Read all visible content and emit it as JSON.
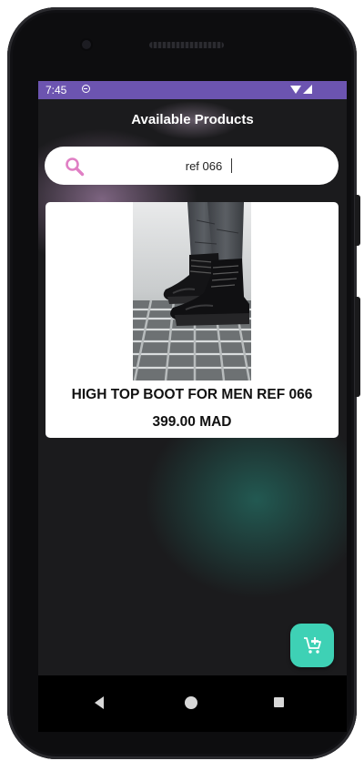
{
  "status_bar": {
    "time": "7:45"
  },
  "app_bar": {
    "title": "Available Products"
  },
  "search": {
    "value": "ref 066",
    "icon": "search-icon"
  },
  "products": [
    {
      "name": "HIGH TOP BOOT FOR MEN REF 066",
      "price": "399.00 MAD",
      "image": "black high top leather boots"
    }
  ],
  "fab": {
    "icon": "add-to-cart-icon"
  },
  "colors": {
    "status_bar": "#6c54b0",
    "fab": "#3ed1b5",
    "search_icon": "#e07fc4",
    "background": "#1b1b1d"
  }
}
